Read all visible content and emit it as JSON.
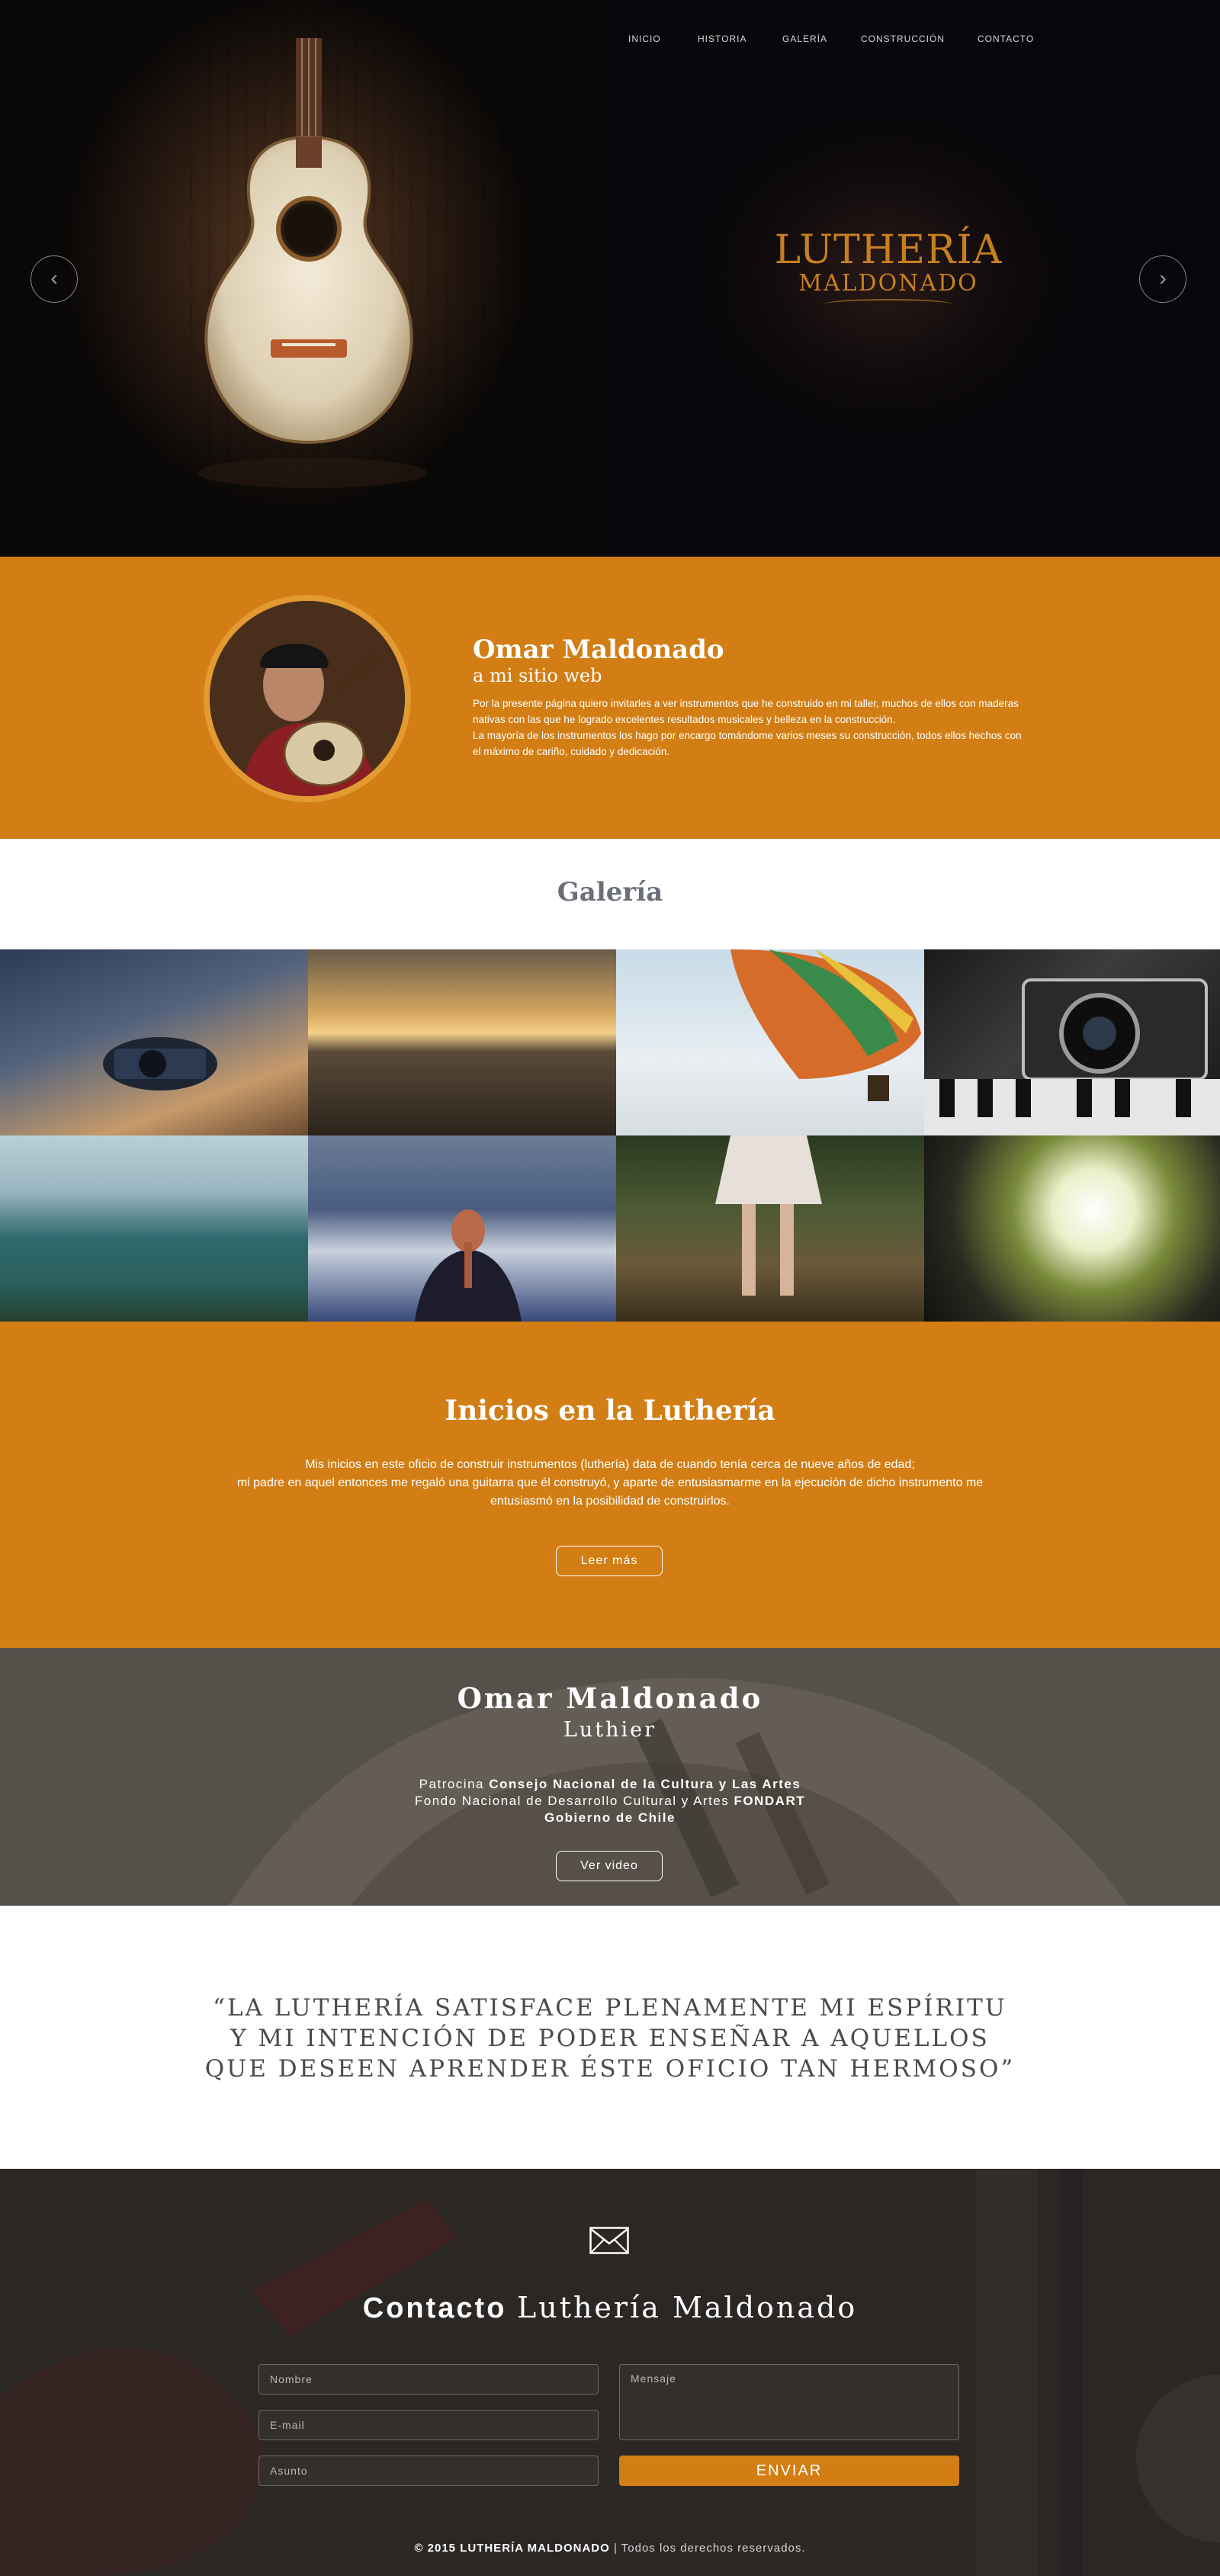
{
  "nav": {
    "items": [
      "INICIO",
      "HISTORIA",
      "GALERÍA",
      "CONSTRUCCIÓN",
      "CONTACTO"
    ]
  },
  "hero": {
    "logo_line1": "LUTHERÍA",
    "logo_line2": "MALDONADO",
    "prev_icon": "chevron-left-icon",
    "next_icon": "chevron-right-icon"
  },
  "about": {
    "name": "Omar Maldonado",
    "subtitle": "a mi sitio web",
    "paragraph1": "Por la presente página quiero invitarles a ver instrumentos que he construido en mi taller, muchos de ellos con maderas nativas con las que he logrado excelentes resultados musicales y belleza en la construcción.",
    "paragraph2": "La mayoría de los instrumentos los hago por encargo tomándome varios meses su construcción, todos ellos hechos con el máximo de cariño, cuidado y dedicación."
  },
  "gallery": {
    "title": "Galería"
  },
  "inicios": {
    "title": "Inicios en la Luthería",
    "line1": "Mis inicios en este oficio de construir instrumentos (luthería) data de cuando tenía cerca de nueve años de edad;",
    "line2": "mi padre en aquel entonces me regaló una guitarra que él construyó, y aparte de entusiasmarme en la ejecución de dicho instrumento me entusiasmó en la posibilidad de construirlos.",
    "button": "Leer más"
  },
  "luthier": {
    "name": "Omar Maldonado",
    "role": "Luthier",
    "sponsor_prefix": "Patrocina",
    "sponsor_name": "Consejo Nacional de la Cultura y Las Artes",
    "fund_prefix": "Fondo Nacional de Desarrollo Cultural y Artes",
    "fund_name": "FONDART",
    "gov": "Gobierno de Chile",
    "button": "Ver video"
  },
  "quote": {
    "line1": "“LA LUTHERÍA SATISFACE PLENAMENTE MI ESPÍRITU",
    "line2": "Y MI INTENCIÓN DE PODER ENSEÑAR A AQUELLOS",
    "line3": "QUE DESEEN APRENDER ÉSTE OFICIO TAN HERMOSO”"
  },
  "contact": {
    "icon": "envelope-icon",
    "title_bold": "Contacto",
    "title_rest": "Luthería Maldonado",
    "name_placeholder": "Nombre",
    "email_placeholder": "E-mail",
    "subject_placeholder": "Asunto",
    "message_placeholder": "Mensaje",
    "submit": "ENVIAR"
  },
  "footer": {
    "copyright": "© 2015 LUTHERÍA MALDONADO",
    "rights": "| Todos los derechos reservados."
  },
  "colors": {
    "accent": "#d27e14",
    "dark": "#07060a",
    "footer_bg": "#2b2725"
  }
}
